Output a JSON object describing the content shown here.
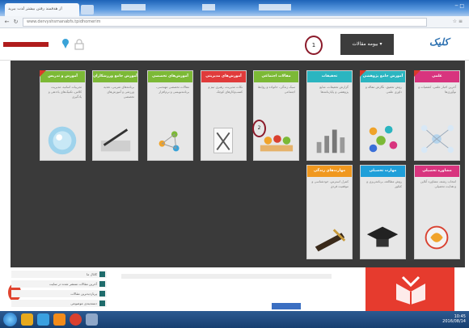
{
  "browser": {
    "tab_title": "از هدفمند رفتن بیشتر لذت ببرید",
    "url": "www.dervyshsmanabfs.tpidhomerim"
  },
  "header": {
    "menu_label": "بیومه مقالات",
    "marker_1": "1",
    "logo_text": "کلیک"
  },
  "mega_menu": {
    "marker_2": "2",
    "cards": [
      {
        "title": "آموزش و تدریس",
        "color": "#7cb936",
        "text": "تجربیات اساتید، مدیریت کلاس، تکنیک‌های یاددهی و یادگیری",
        "art": "globe"
      },
      {
        "title": "آموزش جامع ورزشکاران",
        "color": "#7cb936",
        "text": "برنامه‌های تمرینی، تغذیه ورزشی و آموزش‌های تخصصی",
        "art": "pen"
      },
      {
        "title": "آموزش‌های تخصصی",
        "color": "#7cb936",
        "text": "مقالات تخصصی مهندسی، برنامه‌نویسی و نرم‌افزار",
        "art": "network"
      },
      {
        "title": "آموزش‌های مدیریتی",
        "color": "#e03b3b",
        "text": "نکات مدیریت، رهبری تیم و کسب‌وکارهای کوچک",
        "art": "paper"
      },
      {
        "title": "مقالات اجتماعی",
        "color": "#7cb936",
        "text": "سبک زندگی، خانواده و روابط اجتماعی",
        "art": "people"
      },
      {
        "title": "تحقیقات",
        "color": "#2bb5c0",
        "text": "گزارش تحقیقات، منابع پژوهشی و پایان‌نامه‌ها",
        "art": "chart"
      },
      {
        "title": "آموزش جامع پژوهشی",
        "color": "#2bb5c0",
        "text": "روش تحقیق، نگارش مقاله و داوری علمی",
        "art": "dots"
      },
      {
        "title": "علمی",
        "color": "#d8347e",
        "text": "آخرین اخبار علمی، کشفیات و نوآوری‌ها",
        "art": "mindmap"
      },
      {
        "title": "مهارت‌های زندگی",
        "color": "#f0981f",
        "text": "کنترل استرس، خودشناسی و موفقیت فردی",
        "art": "book"
      },
      {
        "title": "مهارت تحصیلی",
        "color": "#1f9fd9",
        "text": "روش مطالعه، برنامه‌ریزی و کنکور",
        "art": "cap"
      },
      {
        "title": "مشاوره تحصیلی",
        "color": "#d8347e",
        "text": "انتخاب رشته، مشاوره آنلاین و هدایت تحصیلی",
        "art": "logo"
      }
    ]
  },
  "content": {
    "side_items": [
      "کانال ما",
      "آخرین مقالات منتشر شده در سایت",
      "پربازدیدترین مقالات",
      "دسته‌بندی موضوعی"
    ]
  },
  "taskbar": {
    "time": "10:45",
    "date": "2016/08/14"
  }
}
